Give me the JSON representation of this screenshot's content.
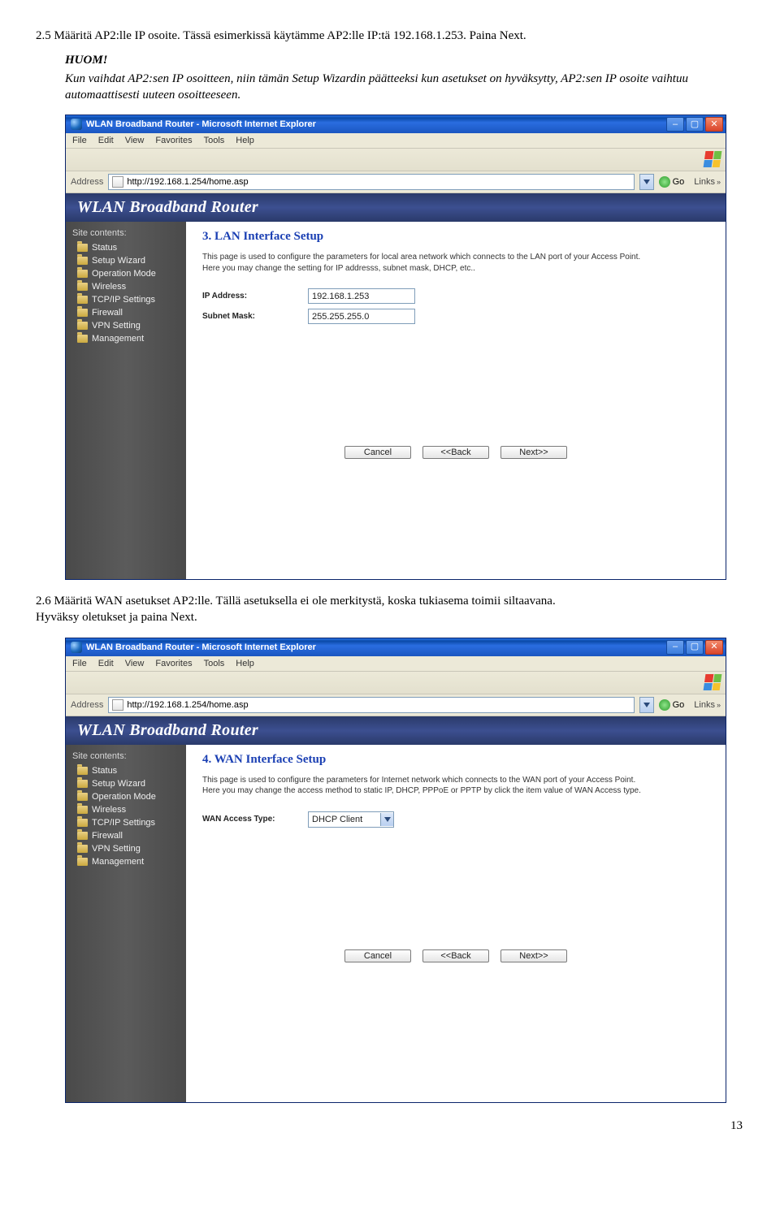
{
  "doc": {
    "sec25_head": "2.5 Määritä AP2:lle IP osoite. Tässä esimerkissä käytämme AP2:lle IP:tä 192.168.1.253. Paina Next.",
    "huom_label": "HUOM!",
    "huom_text": "Kun vaihdat AP2:sen IP osoitteen, niin tämän Setup Wizardin päätteeksi kun asetukset on hyväksytty, AP2:sen IP osoite vaihtuu automaattisesti uuteen osoitteeseen.",
    "sec26_line1": "2.6 Määritä WAN asetukset AP2:lle. Tällä asetuksella ei ole merkitystä, koska tukiasema toimii siltaavana.",
    "sec26_line2": "Hyväksy oletukset ja paina Next.",
    "page_number": "13"
  },
  "browser": {
    "title": "WLAN Broadband Router - Microsoft Internet Explorer",
    "menu": [
      "File",
      "Edit",
      "View",
      "Favorites",
      "Tools",
      "Help"
    ],
    "address_label": "Address",
    "url": "http://192.168.1.254/home.asp",
    "go_label": "Go",
    "links_label": "Links"
  },
  "router": {
    "banner": "WLAN Broadband Router",
    "site_contents": "Site contents:",
    "nav": [
      "Status",
      "Setup Wizard",
      "Operation Mode",
      "Wireless",
      "TCP/IP Settings",
      "Firewall",
      "VPN Setting",
      "Management"
    ]
  },
  "lan": {
    "title": "3. LAN Interface Setup",
    "desc": "This page is used to configure the parameters for local area network which connects to the LAN port of your Access Point. Here you may change the setting for IP addresss, subnet mask, DHCP, etc..",
    "ip_label": "IP Address:",
    "ip_value": "192.168.1.253",
    "mask_label": "Subnet Mask:",
    "mask_value": "255.255.255.0"
  },
  "wan": {
    "title": "4. WAN Interface Setup",
    "desc": "This page is used to configure the parameters for Internet network which connects to the WAN port of your Access Point. Here you may change the access method to static IP, DHCP, PPPoE or PPTP by click the item value of WAN Access type.",
    "type_label": "WAN Access Type:",
    "type_value": "DHCP Client"
  },
  "buttons": {
    "cancel": "Cancel",
    "back": "<<Back",
    "next": "Next>>"
  }
}
